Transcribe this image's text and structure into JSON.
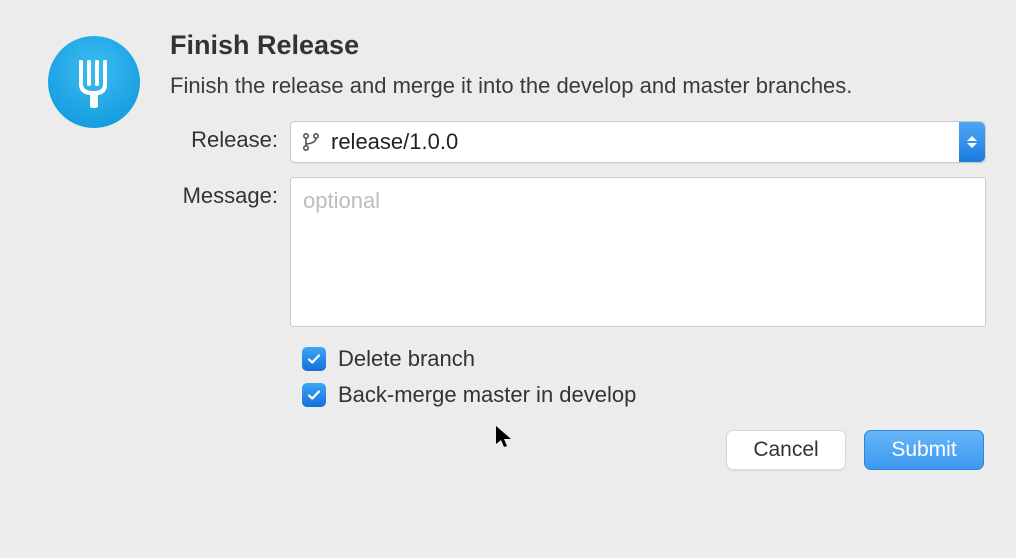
{
  "title": "Finish Release",
  "subtitle": "Finish the release and merge it into the develop and master branches.",
  "form": {
    "release_label": "Release:",
    "release_value": "release/1.0.0",
    "message_label": "Message:",
    "message_value": "",
    "message_placeholder": "optional"
  },
  "checkboxes": {
    "delete_branch": {
      "label": "Delete branch",
      "checked": true
    },
    "back_merge": {
      "label": "Back-merge master in develop",
      "checked": true
    }
  },
  "buttons": {
    "cancel": "Cancel",
    "submit": "Submit"
  },
  "colors": {
    "accent": "#1f8ae6",
    "background": "#ececec"
  }
}
